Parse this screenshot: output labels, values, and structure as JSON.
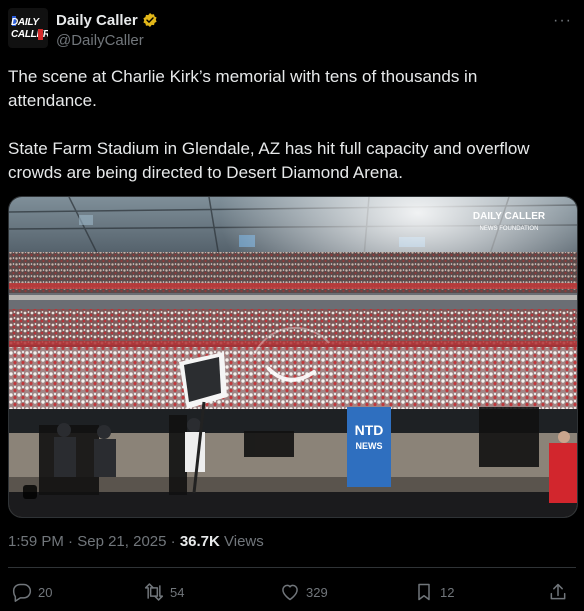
{
  "account": {
    "display_name": "Daily Caller",
    "handle": "@DailyCaller",
    "avatar_line1": "DAILY",
    "avatar_line2": "CALLER",
    "verified_badge_color": "#e2b719"
  },
  "menu": {
    "more_label": "···"
  },
  "post": {
    "paragraph1": "The scene at Charlie Kirk’s memorial with tens of thousands in attendance.",
    "paragraph2": "State Farm Stadium in Glendale, AZ has hit full capacity and overflow crowds are being directed to Desert Diamond Arena."
  },
  "media": {
    "watermark_line1": "DAILY CALLER",
    "watermark_line2": "NEWS FOUNDATION",
    "sign_line1": "NTD",
    "sign_line2": "NEWS"
  },
  "meta": {
    "time": "1:59 PM",
    "sep1": "·",
    "date": "Sep 21, 2025",
    "sep2": "·",
    "views_count": "36.7K",
    "views_label": "Views"
  },
  "actions": {
    "replies": "20",
    "reposts": "54",
    "likes": "329",
    "bookmarks": "12"
  },
  "colors": {
    "background": "#000000",
    "text": "#e7e9ea",
    "muted": "#71767b",
    "divider": "#2f3336"
  }
}
